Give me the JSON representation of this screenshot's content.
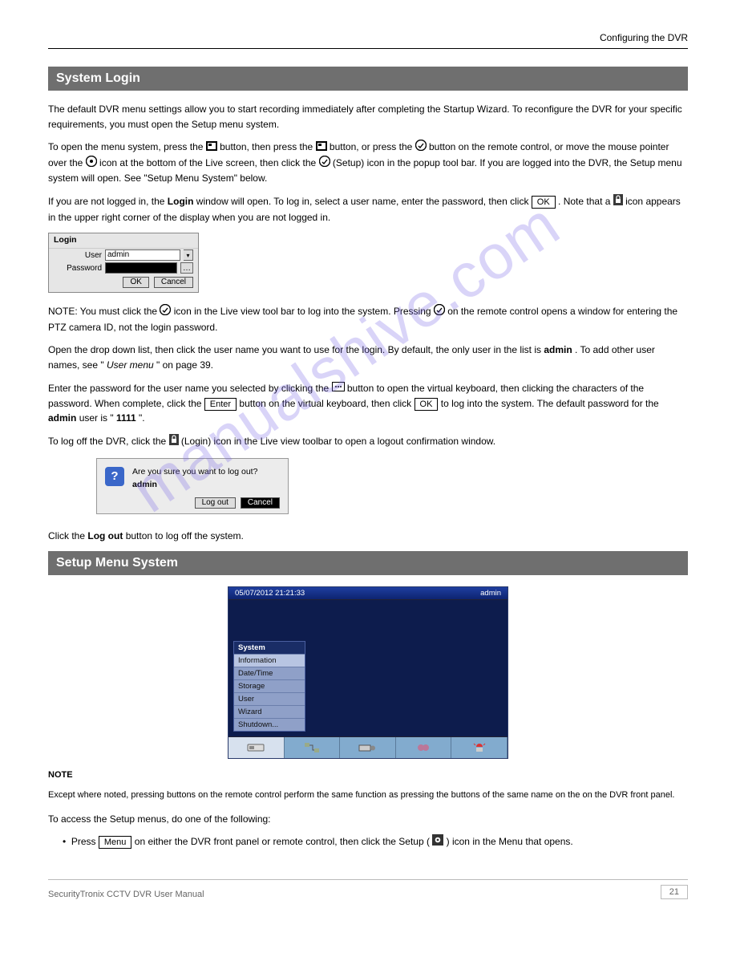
{
  "header": {
    "right": "Configuring the DVR"
  },
  "sections": {
    "login": {
      "title": "System Login",
      "para1": "The default DVR menu settings allow you to start recording immediately after completing the Startup Wizard. To reconfigure the DVR for your specific requirements, you must open the Setup menu system.",
      "para2a": "To open the menu system, press the ",
      "para2b": " button, then press the ",
      "para2c": " button, or press the ",
      "para2d": " button on the remote control, or move the mouse pointer over the ",
      "para2e": " icon at the bottom of the Live screen, then click the ",
      "para2f": " (Setup) icon in the popup tool bar. If you are logged into the DVR, the Setup menu system will open. See \"Setup Menu System\" below.",
      "para3a": "If you are not logged in, the ",
      "para3b": "Login",
      "para3c": " window will open. To log in, select a user name, enter the password, then click ",
      "para3d": ". Note that a ",
      "para3e": " icon appears in the upper right corner of the display when you are not logged in.",
      "menu_key": "Menu",
      "ok_key": "OK",
      "login_dialog": {
        "title": "Login",
        "user_label": "User",
        "user_value": "admin",
        "pass_label": "Password",
        "pass_value": "",
        "ok": "OK",
        "cancel": "Cancel"
      },
      "para4a": "NOTE: You must click the ",
      "para4b": " icon in the Live view tool bar to log into the system. Pressing ",
      "para4c": " on the remote control opens a window for entering the PTZ camera ID, not the login password.",
      "para5a": "Open the drop down list, then click the user name you want to use for the login. By default, the only user in the list is ",
      "para5b": "admin",
      "para5c": ". To add other user names, see \"",
      "para5d": "User menu",
      "para5e": "\" on page 39.",
      "para6a": "Enter the password for the user name you selected by clicking the ",
      "para6b": " button to open the virtual keyboard, then clicking the characters of the password. When complete, click the ",
      "para6c": " button on the virtual keyboard, then click ",
      "para6d": " to log into the system. The default password for the ",
      "para6e": "admin",
      "para6f": " user is \"",
      "para6g": "1111",
      "para6h": "\".",
      "enter_key": "Enter",
      "para7a": "To log off the DVR, click the ",
      "para7b": " (Login) icon in the Live view toolbar to open a logout confirmation window.",
      "logout_dialog": {
        "message": "Are you sure you want to log out?",
        "user": "admin",
        "logout": "Log out",
        "cancel": "Cancel"
      },
      "para8a": "Click the ",
      "para8b": "Log out",
      "para8c": " button to log off the system."
    },
    "setup": {
      "title": "Setup Menu System",
      "screenshot": {
        "datetime": "05/07/2012  21:21:33",
        "user": "admin",
        "menu_title": "System",
        "items": [
          "Information",
          "Date/Time",
          "Storage",
          "User",
          "Wizard",
          "Shutdown..."
        ],
        "selected": "Information",
        "tab_icons": [
          "dvr-icon",
          "network-icon",
          "camera-icon",
          "record-icon",
          "alarm-icon"
        ]
      },
      "note_title": "NOTE",
      "note_text": "Except where noted, pressing buttons on the remote control perform the same function as pressing the buttons of the same name on the on the DVR front panel.",
      "access1a": "To access the Setup menus, do one of the following:",
      "bullet1a": "Press ",
      "bullet1b": " on either the DVR front panel or remote control, then click the Setup ( ",
      "bullet1c": " ) icon in the Menu that opens.",
      "menu_key": "Menu"
    }
  },
  "footer": {
    "left": "SecurityTronix CCTV DVR User Manual",
    "page": "21"
  },
  "watermark": "manualshive.com"
}
